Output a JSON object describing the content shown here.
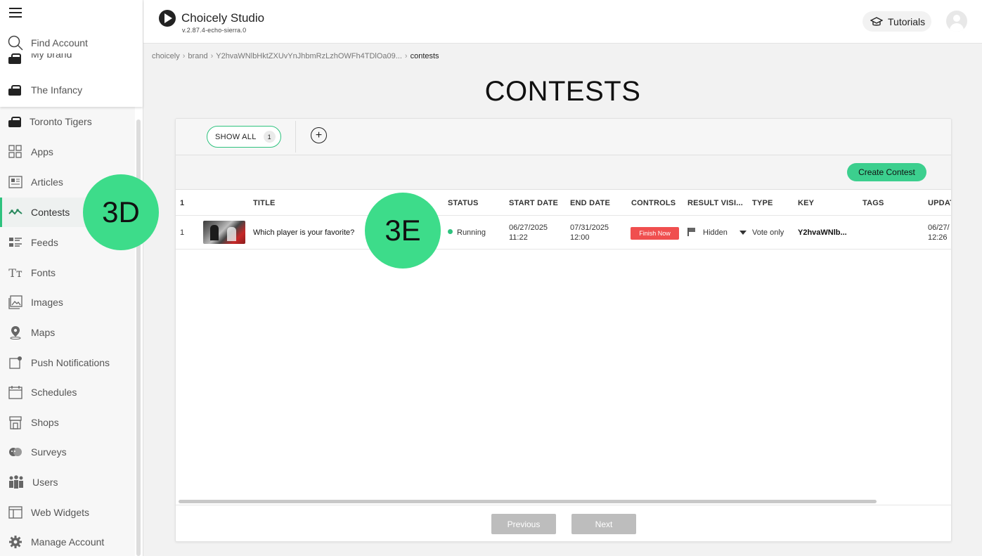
{
  "sidebar": {
    "find_account": "Find Account",
    "brand_partial": "My brand",
    "brand_current": "The Infancy",
    "team": "Toronto Tigers",
    "items": [
      {
        "label": "Apps",
        "icon": "apps-grid-icon"
      },
      {
        "label": "Articles",
        "icon": "articles-icon"
      },
      {
        "label": "Contests",
        "icon": "contests-icon",
        "active": true
      },
      {
        "label": "Feeds",
        "icon": "feeds-icon"
      },
      {
        "label": "Fonts",
        "icon": "fonts-icon"
      },
      {
        "label": "Images",
        "icon": "images-icon"
      },
      {
        "label": "Maps",
        "icon": "map-pin-icon"
      },
      {
        "label": "Push Notifications",
        "icon": "push-notifications-icon"
      },
      {
        "label": "Schedules",
        "icon": "calendar-icon"
      },
      {
        "label": "Shops",
        "icon": "shop-icon"
      },
      {
        "label": "Surveys",
        "icon": "surveys-icon"
      },
      {
        "label": "Users",
        "icon": "users-icon"
      },
      {
        "label": "Web Widgets",
        "icon": "web-widgets-icon"
      },
      {
        "label": "Manage Account",
        "icon": "gear-icon"
      }
    ]
  },
  "header": {
    "title": "Choicely Studio",
    "version": "v.2.87.4-echo-sierra.0",
    "tutorials": "Tutorials"
  },
  "breadcrumb": [
    "choicely",
    "brand",
    "Y2hvaWNlbHktZXUvYnJhbmRzLzhOWFh4TDlOa09...",
    "contests"
  ],
  "page": {
    "title": "CONTESTS"
  },
  "tabs": {
    "show_all": "SHOW ALL",
    "show_all_count": "1",
    "add": "+"
  },
  "toolbar": {
    "create": "Create Contest"
  },
  "table": {
    "headers": [
      "1",
      "TITLE",
      "STATUS",
      "START DATE",
      "END DATE",
      "CONTROLS",
      "RESULT VISI...",
      "TYPE",
      "KEY",
      "TAGS",
      "UPDAT"
    ],
    "rows": [
      {
        "index": "1",
        "title": "Which player is your favorite?",
        "status": "Running",
        "start_date": "06/27/2025",
        "start_time": "11:22",
        "end_date": "07/31/2025",
        "end_time": "12:00",
        "control": "Finish Now",
        "result_visibility": "Hidden",
        "type": "Vote only",
        "key": "Y2hvaWNlb...",
        "tags": "",
        "updated_date": "06/27/",
        "updated_time": "12:26"
      }
    ]
  },
  "pagination": {
    "previous": "Previous",
    "next": "Next"
  },
  "callouts": [
    "3D",
    "3E"
  ],
  "colors": {
    "accent": "#3ccf8e",
    "danger": "#f04f4f",
    "callout": "#3ddc8a"
  }
}
